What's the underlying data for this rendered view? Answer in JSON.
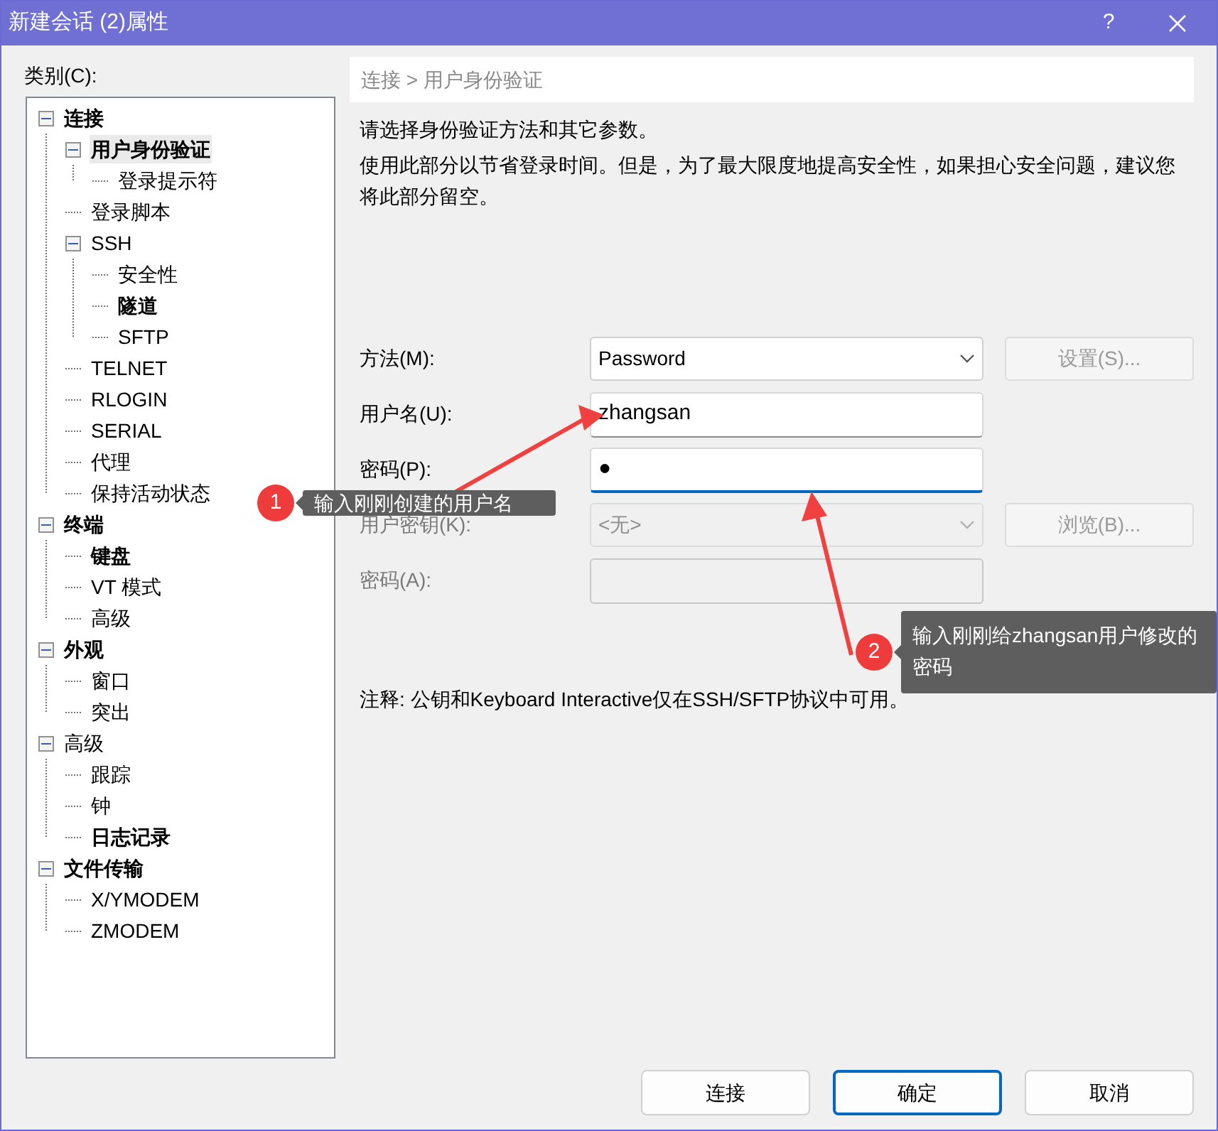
{
  "window": {
    "title": "新建会话 (2)属性",
    "help": "?"
  },
  "category_label": "类别(C):",
  "tree": [
    {
      "label": "连接",
      "bold": true,
      "selected": false,
      "expanded": true,
      "children": [
        {
          "label": "用户身份验证",
          "bold": true,
          "selected": true,
          "expanded": true,
          "children": [
            {
              "label": "登录提示符",
              "bold": false,
              "selected": false
            }
          ]
        },
        {
          "label": "登录脚本",
          "bold": false,
          "selected": false
        },
        {
          "label": "SSH",
          "bold": false,
          "selected": false,
          "expanded": true,
          "children": [
            {
              "label": "安全性",
              "bold": false,
              "selected": false
            },
            {
              "label": "隧道",
              "bold": true,
              "selected": false
            },
            {
              "label": "SFTP",
              "bold": false,
              "selected": false
            }
          ]
        },
        {
          "label": "TELNET",
          "bold": false,
          "selected": false
        },
        {
          "label": "RLOGIN",
          "bold": false,
          "selected": false
        },
        {
          "label": "SERIAL",
          "bold": false,
          "selected": false
        },
        {
          "label": "代理",
          "bold": false,
          "selected": false
        },
        {
          "label": "保持活动状态",
          "bold": false,
          "selected": false
        }
      ]
    },
    {
      "label": "终端",
      "bold": true,
      "selected": false,
      "expanded": true,
      "children": [
        {
          "label": "键盘",
          "bold": true,
          "selected": false
        },
        {
          "label": "VT 模式",
          "bold": false,
          "selected": false
        },
        {
          "label": "高级",
          "bold": false,
          "selected": false
        }
      ]
    },
    {
      "label": "外观",
      "bold": true,
      "selected": false,
      "expanded": true,
      "children": [
        {
          "label": "窗口",
          "bold": false,
          "selected": false
        },
        {
          "label": "突出",
          "bold": false,
          "selected": false
        }
      ]
    },
    {
      "label": "高级",
      "bold": false,
      "selected": false,
      "expanded": true,
      "children": [
        {
          "label": "跟踪",
          "bold": false,
          "selected": false
        },
        {
          "label": "钟",
          "bold": false,
          "selected": false
        },
        {
          "label": "日志记录",
          "bold": true,
          "selected": false
        }
      ]
    },
    {
      "label": "文件传输",
      "bold": true,
      "selected": false,
      "expanded": true,
      "children": [
        {
          "label": "X/YMODEM",
          "bold": false,
          "selected": false
        },
        {
          "label": "ZMODEM",
          "bold": false,
          "selected": false
        }
      ]
    }
  ],
  "breadcrumb": "连接 > 用户身份验证",
  "intro": "请选择身份验证方法和其它参数。",
  "description": "使用此部分以节省登录时间。但是，为了最大限度地提高安全性，如果担心安全问题，建议您将此部分留空。",
  "form": [
    {
      "kind": "select",
      "label": "方法(M):",
      "value": "Password",
      "disabled": false,
      "button": "设置(S)...",
      "button_disabled": true
    },
    {
      "kind": "text",
      "label": "用户名(U):",
      "value": "zhangsan",
      "disabled": false,
      "focused": false
    },
    {
      "kind": "text",
      "label": "密码(P):",
      "value": "●",
      "disabled": false,
      "focused": true
    },
    {
      "kind": "select",
      "label": "用户密钥(K):",
      "value": "<无>",
      "disabled": true,
      "button": "浏览(B)...",
      "button_disabled": true
    },
    {
      "kind": "text",
      "label": "密码(A):",
      "disabled": true,
      "focused": false
    }
  ],
  "note": "注释: 公钥和Keyboard Interactive仅在SSH/SFTP协议中可用。",
  "buttons": [
    {
      "label": "连接",
      "default": false
    },
    {
      "label": "确定",
      "default": true
    },
    {
      "label": "取消",
      "default": false
    }
  ],
  "callouts": [
    {
      "number": "1",
      "text": "输入刚刚创建的用户名"
    },
    {
      "number": "2",
      "text": "输入刚刚给zhangsan用户修改的密码"
    }
  ]
}
